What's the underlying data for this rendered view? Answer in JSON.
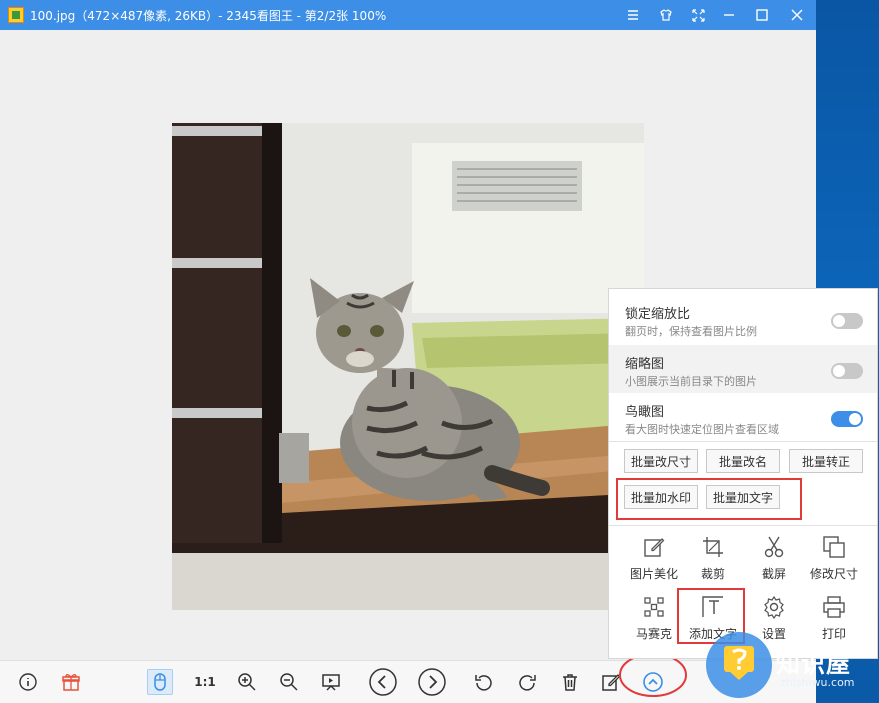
{
  "window": {
    "title": "100.jpg（472×487像素, 26KB）- 2345看图王 - 第2/2张 100%",
    "controls": [
      "menu-icon",
      "skin-icon",
      "fullscreen-icon",
      "minimize-icon",
      "maximize-icon",
      "close-icon"
    ]
  },
  "panel": {
    "options": [
      {
        "title": "锁定缩放比",
        "desc": "翻页时，保持查看图片比例",
        "enabled": false
      },
      {
        "title": "缩略图",
        "desc": "小图展示当前目录下的图片",
        "enabled": false
      },
      {
        "title": "鸟瞰图",
        "desc": "看大图时快速定位图片查看区域",
        "enabled": true
      }
    ],
    "batch_buttons": [
      "批量改尺寸",
      "批量改名",
      "批量转正",
      "批量加水印",
      "批量加文字"
    ],
    "tools": [
      {
        "label": "图片美化",
        "icon": "edit-icon"
      },
      {
        "label": "裁剪",
        "icon": "crop-icon"
      },
      {
        "label": "截屏",
        "icon": "scissors-icon"
      },
      {
        "label": "修改尺寸",
        "icon": "resize-icon"
      },
      {
        "label": "马赛克",
        "icon": "mosaic-icon"
      },
      {
        "label": "添加文字",
        "icon": "add-text-icon"
      },
      {
        "label": "设置",
        "icon": "gear-icon"
      },
      {
        "label": "打印",
        "icon": "printer-icon"
      }
    ]
  },
  "toolbar": {
    "actual_size_label": "1:1"
  },
  "watermark": {
    "brand": "知识屋",
    "domain": "zhishiwu.com"
  },
  "colors": {
    "titlebar": "#3c8ee6",
    "accent": "#3c8ee6",
    "highlight": "#e23a3a"
  }
}
